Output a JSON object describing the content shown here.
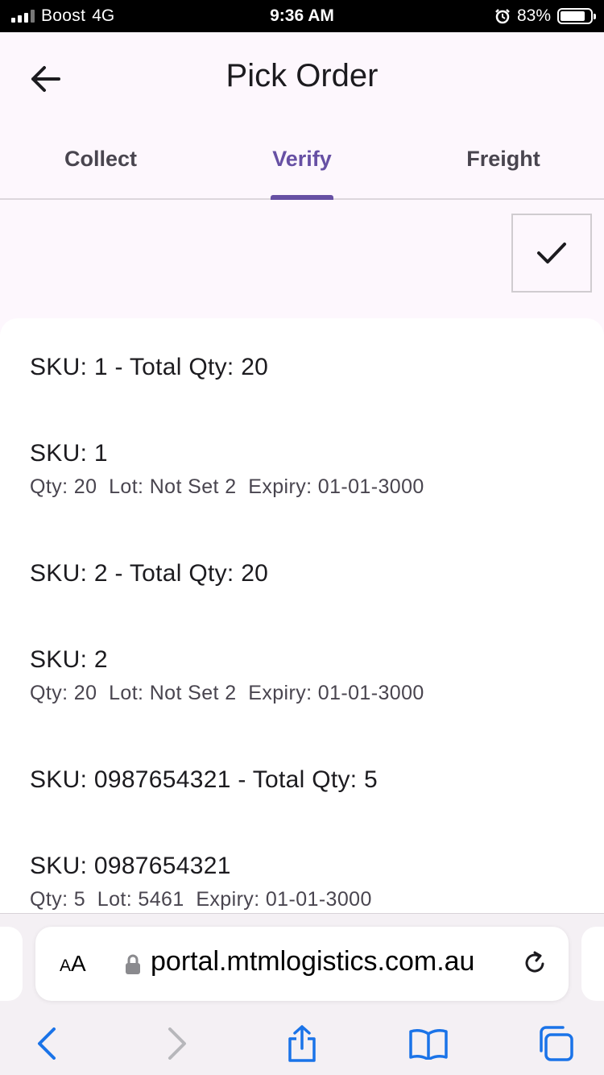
{
  "status_bar": {
    "carrier": "Boost",
    "network": "4G",
    "time": "9:36 AM",
    "battery": "83%",
    "battery_level": 0.83
  },
  "header": {
    "title": "Pick Order",
    "back_icon": "arrow-left-icon"
  },
  "tabs": [
    {
      "label": "Collect",
      "active": false
    },
    {
      "label": "Verify",
      "active": true
    },
    {
      "label": "Freight",
      "active": false
    }
  ],
  "actions": {
    "confirm_icon": "checkmark-icon"
  },
  "items": [
    {
      "primary": "SKU: 1 - Total Qty: 20",
      "secondary": ""
    },
    {
      "primary": "SKU: 1",
      "secondary": "Qty: 20  Lot: Not Set 2  Expiry: 01-01-3000"
    },
    {
      "primary": "SKU: 2 - Total Qty: 20",
      "secondary": ""
    },
    {
      "primary": "SKU: 2",
      "secondary": "Qty: 20  Lot: Not Set 2  Expiry: 01-01-3000"
    },
    {
      "primary": "SKU: 0987654321 - Total Qty: 5",
      "secondary": ""
    },
    {
      "primary": "SKU: 0987654321",
      "secondary": "Qty: 5  Lot: 5461  Expiry: 01-01-3000"
    }
  ],
  "browser": {
    "aa_label_small": "A",
    "aa_label_large": "A",
    "url": "portal.mtmlogistics.com.au"
  },
  "colors": {
    "accent": "#6750a4",
    "ios_blue": "#1a73e8"
  }
}
